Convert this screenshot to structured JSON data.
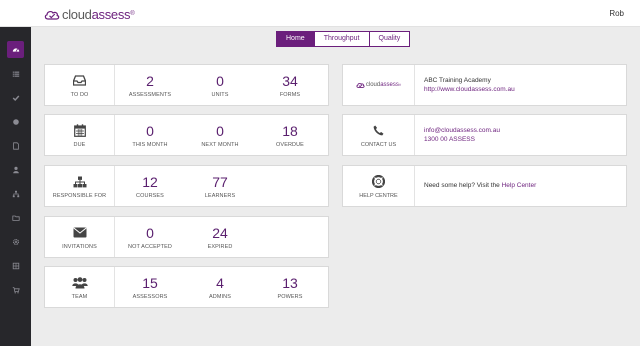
{
  "brand": {
    "name_part1": "cloud",
    "name_part2": "assess",
    "mark": "®"
  },
  "user": {
    "name": "Rob"
  },
  "tabs": [
    {
      "label": "Home",
      "active": true
    },
    {
      "label": "Throughput",
      "active": false
    },
    {
      "label": "Quality",
      "active": false
    }
  ],
  "sidebar": {
    "items": [
      {
        "icon": "dashboard-icon",
        "active": true
      },
      {
        "icon": "list-icon",
        "active": false
      },
      {
        "icon": "check-icon",
        "active": false
      },
      {
        "icon": "circle-icon",
        "active": false
      },
      {
        "icon": "document-icon",
        "active": false
      },
      {
        "icon": "user-icon",
        "active": false
      },
      {
        "icon": "org-chart-icon",
        "active": false
      },
      {
        "icon": "folder-icon",
        "active": false
      },
      {
        "icon": "gear-icon",
        "active": false
      },
      {
        "icon": "grid-icon",
        "active": false
      },
      {
        "icon": "cart-icon",
        "active": false
      }
    ]
  },
  "cards": {
    "todo": {
      "label": "TO DO",
      "icon": "inbox-icon",
      "stats": [
        {
          "value": "2",
          "caption": "ASSESSMENTS"
        },
        {
          "value": "0",
          "caption": "UNITS"
        },
        {
          "value": "34",
          "caption": "FORMS"
        }
      ]
    },
    "due": {
      "label": "DUE",
      "icon": "calendar-icon",
      "stats": [
        {
          "value": "0",
          "caption": "THIS MONTH"
        },
        {
          "value": "0",
          "caption": "NEXT MONTH"
        },
        {
          "value": "18",
          "caption": "OVERDUE"
        }
      ]
    },
    "responsible": {
      "label": "RESPONSIBLE FOR",
      "icon": "sitemap-icon",
      "stats": [
        {
          "value": "12",
          "caption": "COURSES"
        },
        {
          "value": "77",
          "caption": "LEARNERS"
        }
      ]
    },
    "invitations": {
      "label": "INVITATIONS",
      "icon": "envelope-icon",
      "stats": [
        {
          "value": "0",
          "caption": "NOT ACCEPTED"
        },
        {
          "value": "24",
          "caption": "EXPIRED"
        }
      ]
    },
    "team": {
      "label": "TEAM",
      "icon": "team-icon",
      "stats": [
        {
          "value": "15",
          "caption": "ASSESSORS"
        },
        {
          "value": "4",
          "caption": "ADMINS"
        },
        {
          "value": "13",
          "caption": "POWERS"
        }
      ]
    }
  },
  "org": {
    "logo_part1": "cloud",
    "logo_part2": "assess",
    "logo_mark": "®",
    "name": "ABC Training Academy",
    "url": "http://www.cloudassess.com.au"
  },
  "contact": {
    "label": "CONTACT US",
    "icon": "phone-icon",
    "email": "info@cloudassess.com.au",
    "phone": "1300 00 ASSESS"
  },
  "help": {
    "label": "HELP CENTRE",
    "icon": "lifebuoy-icon",
    "text": "Need some help? Visit the ",
    "link": "Help Center"
  },
  "colors": {
    "brand": "#6b1f7c",
    "sidebar": "#27272b",
    "number": "#5a1f6e"
  }
}
